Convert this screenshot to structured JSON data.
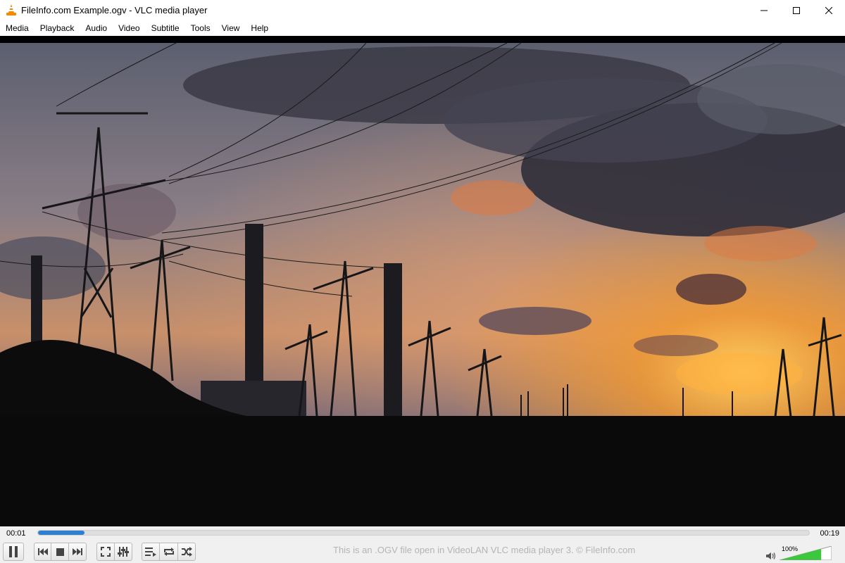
{
  "window": {
    "title": "FileInfo.com Example.ogv - VLC media player",
    "app_icon": "vlc-cone-icon"
  },
  "menu": [
    "Media",
    "Playback",
    "Audio",
    "Video",
    "Subtitle",
    "Tools",
    "View",
    "Help"
  ],
  "playback": {
    "elapsed": "00:01",
    "total": "00:19",
    "progress_fraction": 0.06
  },
  "controls": {
    "icons": [
      "pause-icon",
      "previous-icon",
      "stop-icon",
      "next-icon",
      "fullscreen-icon",
      "extended-settings-icon",
      "playlist-icon",
      "loop-icon",
      "shuffle-icon"
    ],
    "status_text": "This is an .OGV file open in VideoLAN VLC media player 3. © FileInfo.com"
  },
  "volume": {
    "label": "100%",
    "level_fraction": 0.8,
    "icon": "speaker-icon"
  },
  "colors": {
    "progress": "#2f7fd0",
    "volume": "#3cc83c",
    "status_text": "#b4b4b4"
  }
}
